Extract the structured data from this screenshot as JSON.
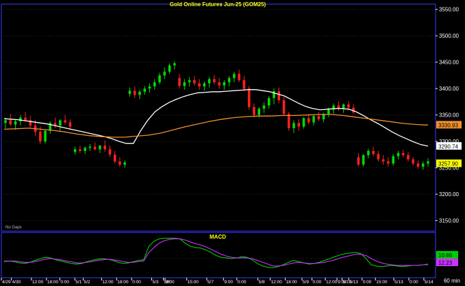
{
  "chart_data": [
    {
      "type": "candlestick",
      "title": "Gold Online Futures Jun-25 (GOM25)",
      "note": "No Gaps",
      "ylim": [
        3130,
        3560
      ],
      "y_ticks": [
        3150,
        3200,
        3250,
        3300,
        3350,
        3400,
        3450,
        3500,
        3550
      ],
      "y_tick_labels": [
        "3150.00",
        "3200.00",
        "3250.00",
        "3300.00",
        "3350.00",
        "3400.00",
        "3450.00",
        "3500.00",
        "3550.00"
      ],
      "grid": true,
      "x_count": 100,
      "candles": [
        [
          3335,
          3345,
          3325,
          3340
        ],
        [
          3340,
          3352,
          3330,
          3332
        ],
        [
          3332,
          3342,
          3322,
          3338
        ],
        [
          3338,
          3350,
          3330,
          3345
        ],
        [
          3345,
          3356,
          3338,
          3340
        ],
        [
          3340,
          3348,
          3325,
          3330
        ],
        [
          3330,
          3340,
          3310,
          3318
        ],
        [
          3318,
          3328,
          3295,
          3300
        ],
        [
          3300,
          3322,
          3296,
          3320
        ],
        [
          3320,
          3338,
          3315,
          3335
        ],
        [
          3335,
          3345,
          3325,
          3330
        ],
        [
          3330,
          3342,
          3318,
          3340
        ],
        [
          3340,
          3350,
          3332,
          3336
        ],
        [
          3336,
          3342,
          3322,
          3328
        ],
        [
          3280,
          3290,
          3275,
          3285
        ],
        [
          3285,
          3292,
          3278,
          3282
        ],
        [
          3282,
          3290,
          3276,
          3288
        ],
        [
          3288,
          3295,
          3282,
          3290
        ],
        [
          3290,
          3298,
          3283,
          3285
        ],
        [
          3285,
          3293,
          3278,
          3292
        ],
        [
          3292,
          3302,
          3280,
          3285
        ],
        [
          3285,
          3292,
          3270,
          3275
        ],
        [
          3275,
          3282,
          3258,
          3262
        ],
        [
          3262,
          3270,
          3252,
          3256
        ],
        [
          3256,
          3264,
          3250,
          3260
        ],
        [
          3390,
          3402,
          3385,
          3396
        ],
        [
          3396,
          3404,
          3382,
          3388
        ],
        [
          3388,
          3398,
          3380,
          3394
        ],
        [
          3394,
          3405,
          3388,
          3400
        ],
        [
          3400,
          3410,
          3392,
          3404
        ],
        [
          3404,
          3418,
          3398,
          3412
        ],
        [
          3412,
          3430,
          3408,
          3425
        ],
        [
          3425,
          3440,
          3418,
          3432
        ],
        [
          3432,
          3448,
          3428,
          3444
        ],
        [
          3444,
          3452,
          3436,
          3448
        ],
        [
          3420,
          3428,
          3400,
          3405
        ],
        [
          3405,
          3418,
          3398,
          3412
        ],
        [
          3412,
          3422,
          3404,
          3416
        ],
        [
          3416,
          3424,
          3406,
          3410
        ],
        [
          3410,
          3418,
          3398,
          3404
        ],
        [
          3404,
          3414,
          3396,
          3410
        ],
        [
          3410,
          3422,
          3402,
          3418
        ],
        [
          3418,
          3426,
          3408,
          3412
        ],
        [
          3412,
          3420,
          3400,
          3406
        ],
        [
          3406,
          3416,
          3398,
          3412
        ],
        [
          3412,
          3424,
          3404,
          3420
        ],
        [
          3420,
          3432,
          3412,
          3428
        ],
        [
          3428,
          3436,
          3412,
          3416
        ],
        [
          3416,
          3424,
          3395,
          3400
        ],
        [
          3400,
          3405,
          3360,
          3365
        ],
        [
          3365,
          3372,
          3345,
          3350
        ],
        [
          3350,
          3365,
          3345,
          3362
        ],
        [
          3362,
          3374,
          3354,
          3368
        ],
        [
          3368,
          3386,
          3362,
          3382
        ],
        [
          3382,
          3400,
          3370,
          3395
        ],
        [
          3395,
          3402,
          3372,
          3378
        ],
        [
          3378,
          3384,
          3348,
          3352
        ],
        [
          3352,
          3356,
          3320,
          3325
        ],
        [
          3325,
          3340,
          3316,
          3335
        ],
        [
          3335,
          3342,
          3320,
          3328
        ],
        [
          3328,
          3346,
          3324,
          3344
        ],
        [
          3344,
          3352,
          3332,
          3336
        ],
        [
          3336,
          3350,
          3330,
          3348
        ],
        [
          3348,
          3356,
          3338,
          3342
        ],
        [
          3342,
          3354,
          3336,
          3352
        ],
        [
          3352,
          3364,
          3346,
          3360
        ],
        [
          3360,
          3372,
          3352,
          3368
        ],
        [
          3368,
          3376,
          3358,
          3362
        ],
        [
          3362,
          3372,
          3354,
          3370
        ],
        [
          3370,
          3376,
          3358,
          3364
        ],
        [
          3364,
          3370,
          3352,
          3355
        ],
        [
          3270,
          3278,
          3252,
          3256
        ],
        [
          3256,
          3276,
          3252,
          3274
        ],
        [
          3274,
          3286,
          3268,
          3282
        ],
        [
          3282,
          3290,
          3272,
          3276
        ],
        [
          3276,
          3282,
          3262,
          3266
        ],
        [
          3266,
          3274,
          3256,
          3262
        ],
        [
          3262,
          3270,
          3252,
          3258
        ],
        [
          3258,
          3276,
          3254,
          3272
        ],
        [
          3272,
          3282,
          3266,
          3278
        ],
        [
          3278,
          3284,
          3270,
          3274
        ],
        [
          3274,
          3280,
          3262,
          3266
        ],
        [
          3266,
          3270,
          3254,
          3258
        ],
        [
          3258,
          3264,
          3248,
          3252
        ],
        [
          3252,
          3262,
          3246,
          3258
        ],
        [
          3258,
          3268,
          3252,
          3262
        ]
      ],
      "series": [
        {
          "color": "#ffffff",
          "values": [
            3343,
            3342,
            3341,
            3339,
            3337,
            3335,
            3333,
            3330,
            3327,
            3324,
            3321,
            3318,
            3315,
            3312,
            3309,
            3305,
            3300,
            3296,
            3296,
            3320,
            3340,
            3356,
            3366,
            3374,
            3380,
            3385,
            3389,
            3392,
            3393,
            3394,
            3394,
            3395,
            3396,
            3397,
            3398,
            3398,
            3396,
            3394,
            3390,
            3386,
            3379,
            3372,
            3366,
            3362,
            3360,
            3361,
            3362,
            3362,
            3361,
            3356,
            3349,
            3341,
            3334,
            3326,
            3318,
            3311,
            3305,
            3299,
            3294,
            3291
          ]
        },
        {
          "color": "#f0902c",
          "values": [
            3323,
            3324,
            3325,
            3323,
            3321,
            3318,
            3314,
            3311,
            3309,
            3308,
            3308,
            3310,
            3312,
            3316,
            3322,
            3328,
            3333,
            3338,
            3342,
            3345,
            3347,
            3348,
            3348,
            3349,
            3349,
            3350,
            3351,
            3351,
            3349,
            3346,
            3343,
            3340,
            3337,
            3334,
            3332,
            3331
          ]
        }
      ],
      "last_values": [
        {
          "label": "3330.93",
          "value": 3330.93,
          "bg": "#f0902c"
        },
        {
          "label": "3290.74",
          "value": 3290.74,
          "bg": "#ffffff"
        },
        {
          "label": "3257.90",
          "value": 3257.9,
          "bg": "#ffff00"
        }
      ]
    },
    {
      "type": "line",
      "title": "MACD",
      "ylim": [
        -30,
        40
      ],
      "series": [
        {
          "color": "#00cc00",
          "values": [
            -5,
            -4,
            -5,
            -7,
            -8,
            -6,
            -3,
            0,
            2,
            1,
            -2,
            -4,
            -6,
            -8,
            -9,
            -8,
            -5,
            -3,
            -1,
            0,
            -1,
            -3,
            -6,
            -8,
            -7,
            -5,
            -3,
            -2,
            20,
            28,
            32,
            33,
            33,
            33,
            32,
            25,
            20,
            18,
            17,
            14,
            10,
            5,
            2,
            1,
            0,
            1,
            3,
            2,
            -2,
            -8,
            -12,
            -14,
            -15,
            -13,
            -10,
            -6,
            -3,
            -5,
            -7,
            -9,
            -8,
            -6,
            -3,
            0,
            3,
            6,
            8,
            9,
            10,
            8,
            0,
            -10,
            -12,
            -13,
            -12,
            -11,
            -12,
            -13,
            -12,
            -11,
            -11,
            -10,
            -9
          ]
        },
        {
          "color": "#cc33ff",
          "values": [
            -4,
            -4,
            -4,
            -5,
            -6,
            -6,
            -5,
            -3,
            -1,
            0,
            -1,
            -2,
            -4,
            -5,
            -7,
            -7,
            -6,
            -5,
            -3,
            -2,
            -1,
            -2,
            -3,
            -5,
            -6,
            -6,
            -5,
            -4,
            10,
            18,
            25,
            29,
            31,
            32,
            32,
            30,
            27,
            24,
            22,
            19,
            15,
            11,
            7,
            4,
            2,
            1,
            1,
            1,
            0,
            -3,
            -6,
            -9,
            -12,
            -12,
            -11,
            -9,
            -7,
            -6,
            -7,
            -8,
            -8,
            -7,
            -6,
            -4,
            -2,
            1,
            3,
            5,
            7,
            7,
            5,
            0,
            -4,
            -7,
            -9,
            -10,
            -11,
            -11,
            -11,
            -11,
            -11,
            -10,
            -10
          ]
        }
      ],
      "last_values": [
        {
          "label": "10.66",
          "value": 10.66,
          "bg": "#00cc00"
        },
        {
          "label": "12.23",
          "value": 12.23,
          "bg": "#cc33ff"
        }
      ],
      "x_tick_labels": [
        {
          "label": "4/29",
          "at": 0.0
        },
        {
          "label": "4/30",
          "at": 0.03
        },
        {
          "label": "12:00",
          "at": 0.09
        },
        {
          "label": "18:00",
          "at": 0.135
        },
        {
          "label": "0:00",
          "at": 0.175
        },
        {
          "label": "5/1",
          "at": 0.22
        },
        {
          "label": "5/2",
          "at": 0.245
        },
        {
          "label": "12:00",
          "at": 0.3
        },
        {
          "label": "18:00",
          "at": 0.345
        },
        {
          "label": "0:00",
          "at": 0.39
        },
        {
          "label": "5/3",
          "at": 0.45
        },
        {
          "label": "5/6",
          "at": 0.485
        },
        {
          "label": "9:00",
          "at": 0.49
        },
        {
          "label": "15:00",
          "at": 0.555
        },
        {
          "label": "5/7",
          "at": 0.615
        },
        {
          "label": "9:00",
          "at": 0.665
        },
        {
          "label": "0:00",
          "at": 0.705
        },
        {
          "label": "5/8",
          "at": 0.768
        },
        {
          "label": "12:00",
          "at": 0.805
        },
        {
          "label": "18:00",
          "at": 0.85
        },
        {
          "label": "5/9",
          "at": 0.9
        },
        {
          "label": "0:00",
          "at": 0.93
        },
        {
          "label": "12:00",
          "at": 0.97
        },
        {
          "label": "9:00",
          "at": 1.005
        },
        {
          "label": "5/10",
          "at": 1.02
        },
        {
          "label": "5/13",
          "at": 1.04
        },
        {
          "label": "0:00",
          "at": 1.08
        },
        {
          "label": "15:00",
          "at": 1.12
        },
        {
          "label": "5/13",
          "at": 1.175
        },
        {
          "label": "0:00",
          "at": 1.22
        },
        {
          "label": "5/14",
          "at": 1.265
        }
      ],
      "period": "60 min"
    }
  ]
}
